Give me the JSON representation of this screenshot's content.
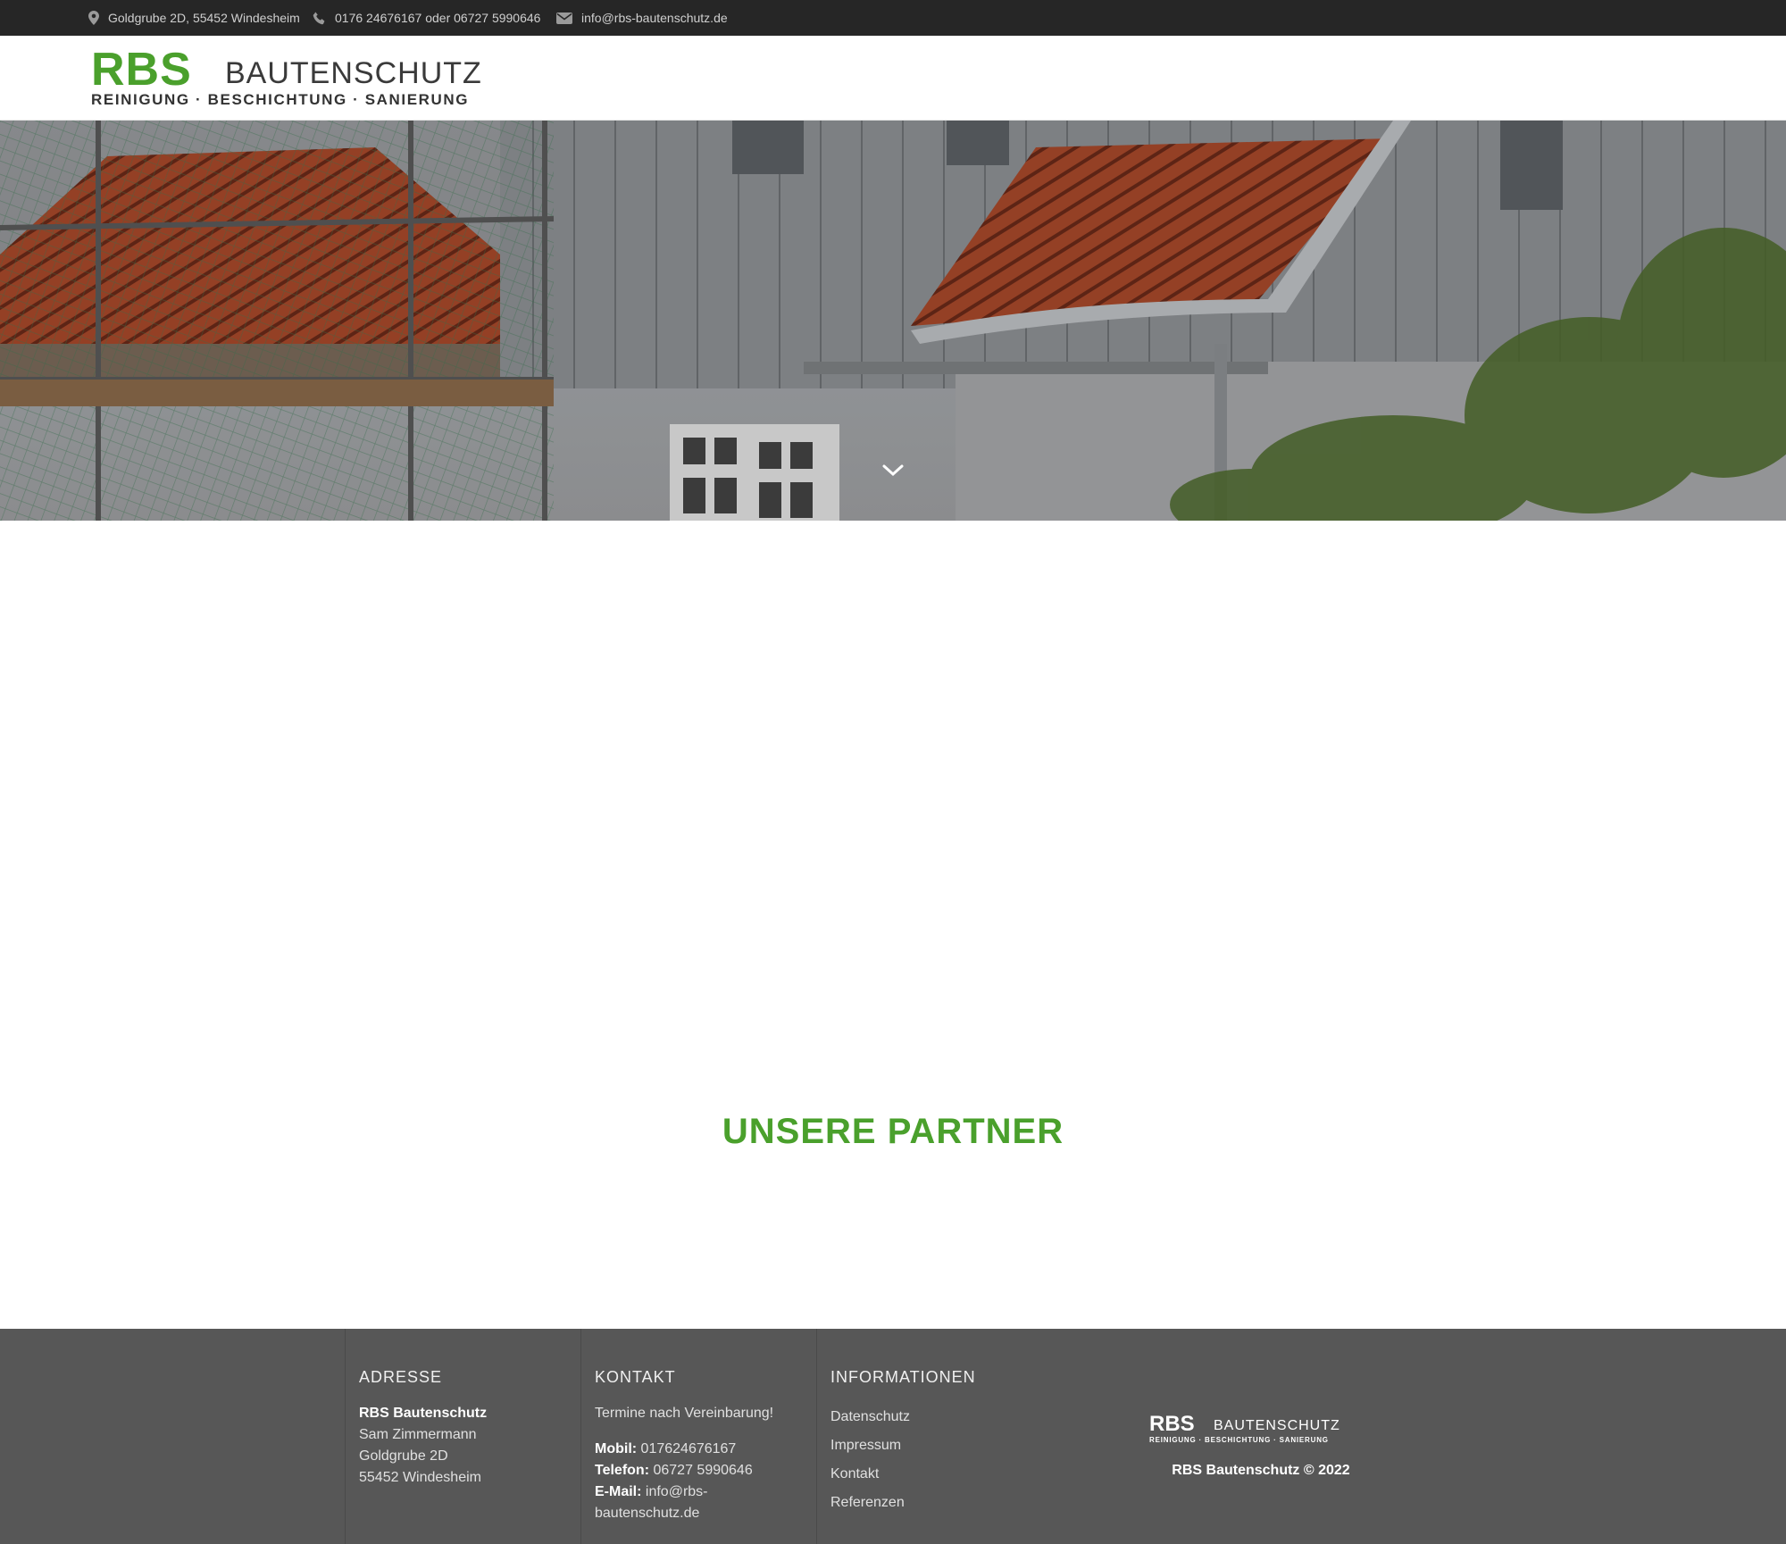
{
  "topbar": {
    "address": "Goldgrube 2D, 55452 Windesheim",
    "phone": "0176 24676167 oder 06727 5990646",
    "email": "info@rbs-bautenschutz.de",
    "icons": [
      "map-marker-icon",
      "phone-icon",
      "envelope-icon"
    ]
  },
  "logo": {
    "brand": "RBS",
    "name": "BAUTENSCHUTZ",
    "tagline": "REINIGUNG · BESCHICHTUNG · SANIERUNG"
  },
  "hero": {
    "scroll_icon": "chevron-down-icon"
  },
  "partner": {
    "title": "UNSERE PARTNER"
  },
  "footer": {
    "address": {
      "heading": "ADRESSE",
      "company": "RBS Bautenschutz",
      "person": "Sam Zimmermann",
      "street": "Goldgrube 2D",
      "city": "55452 Windesheim"
    },
    "contact": {
      "heading": "KONTAKT",
      "note": "Termine nach Vereinbarung!",
      "mobile_label": "Mobil:",
      "mobile_value": "017624676167",
      "phone_label": "Telefon:",
      "phone_value": "06727 5990646",
      "email_label": "E-Mail:",
      "email_value_1": "info@rbs-",
      "email_value_2": "bautenschutz.de"
    },
    "info": {
      "heading": "INFORMATIONEN",
      "links": [
        "Datenschutz",
        "Impressum",
        "Kontakt",
        "Referenzen"
      ]
    },
    "logo": {
      "brand": "RBS",
      "name": "BAUTENSCHUTZ",
      "tagline": "REINIGUNG · BESCHICHTUNG · SANIERUNG"
    },
    "copyright": "RBS Bautenschutz © 2022"
  },
  "colors": {
    "accent_green": "#4aa02c",
    "topbar_bg": "#262626",
    "footer_bg": "#575757"
  }
}
